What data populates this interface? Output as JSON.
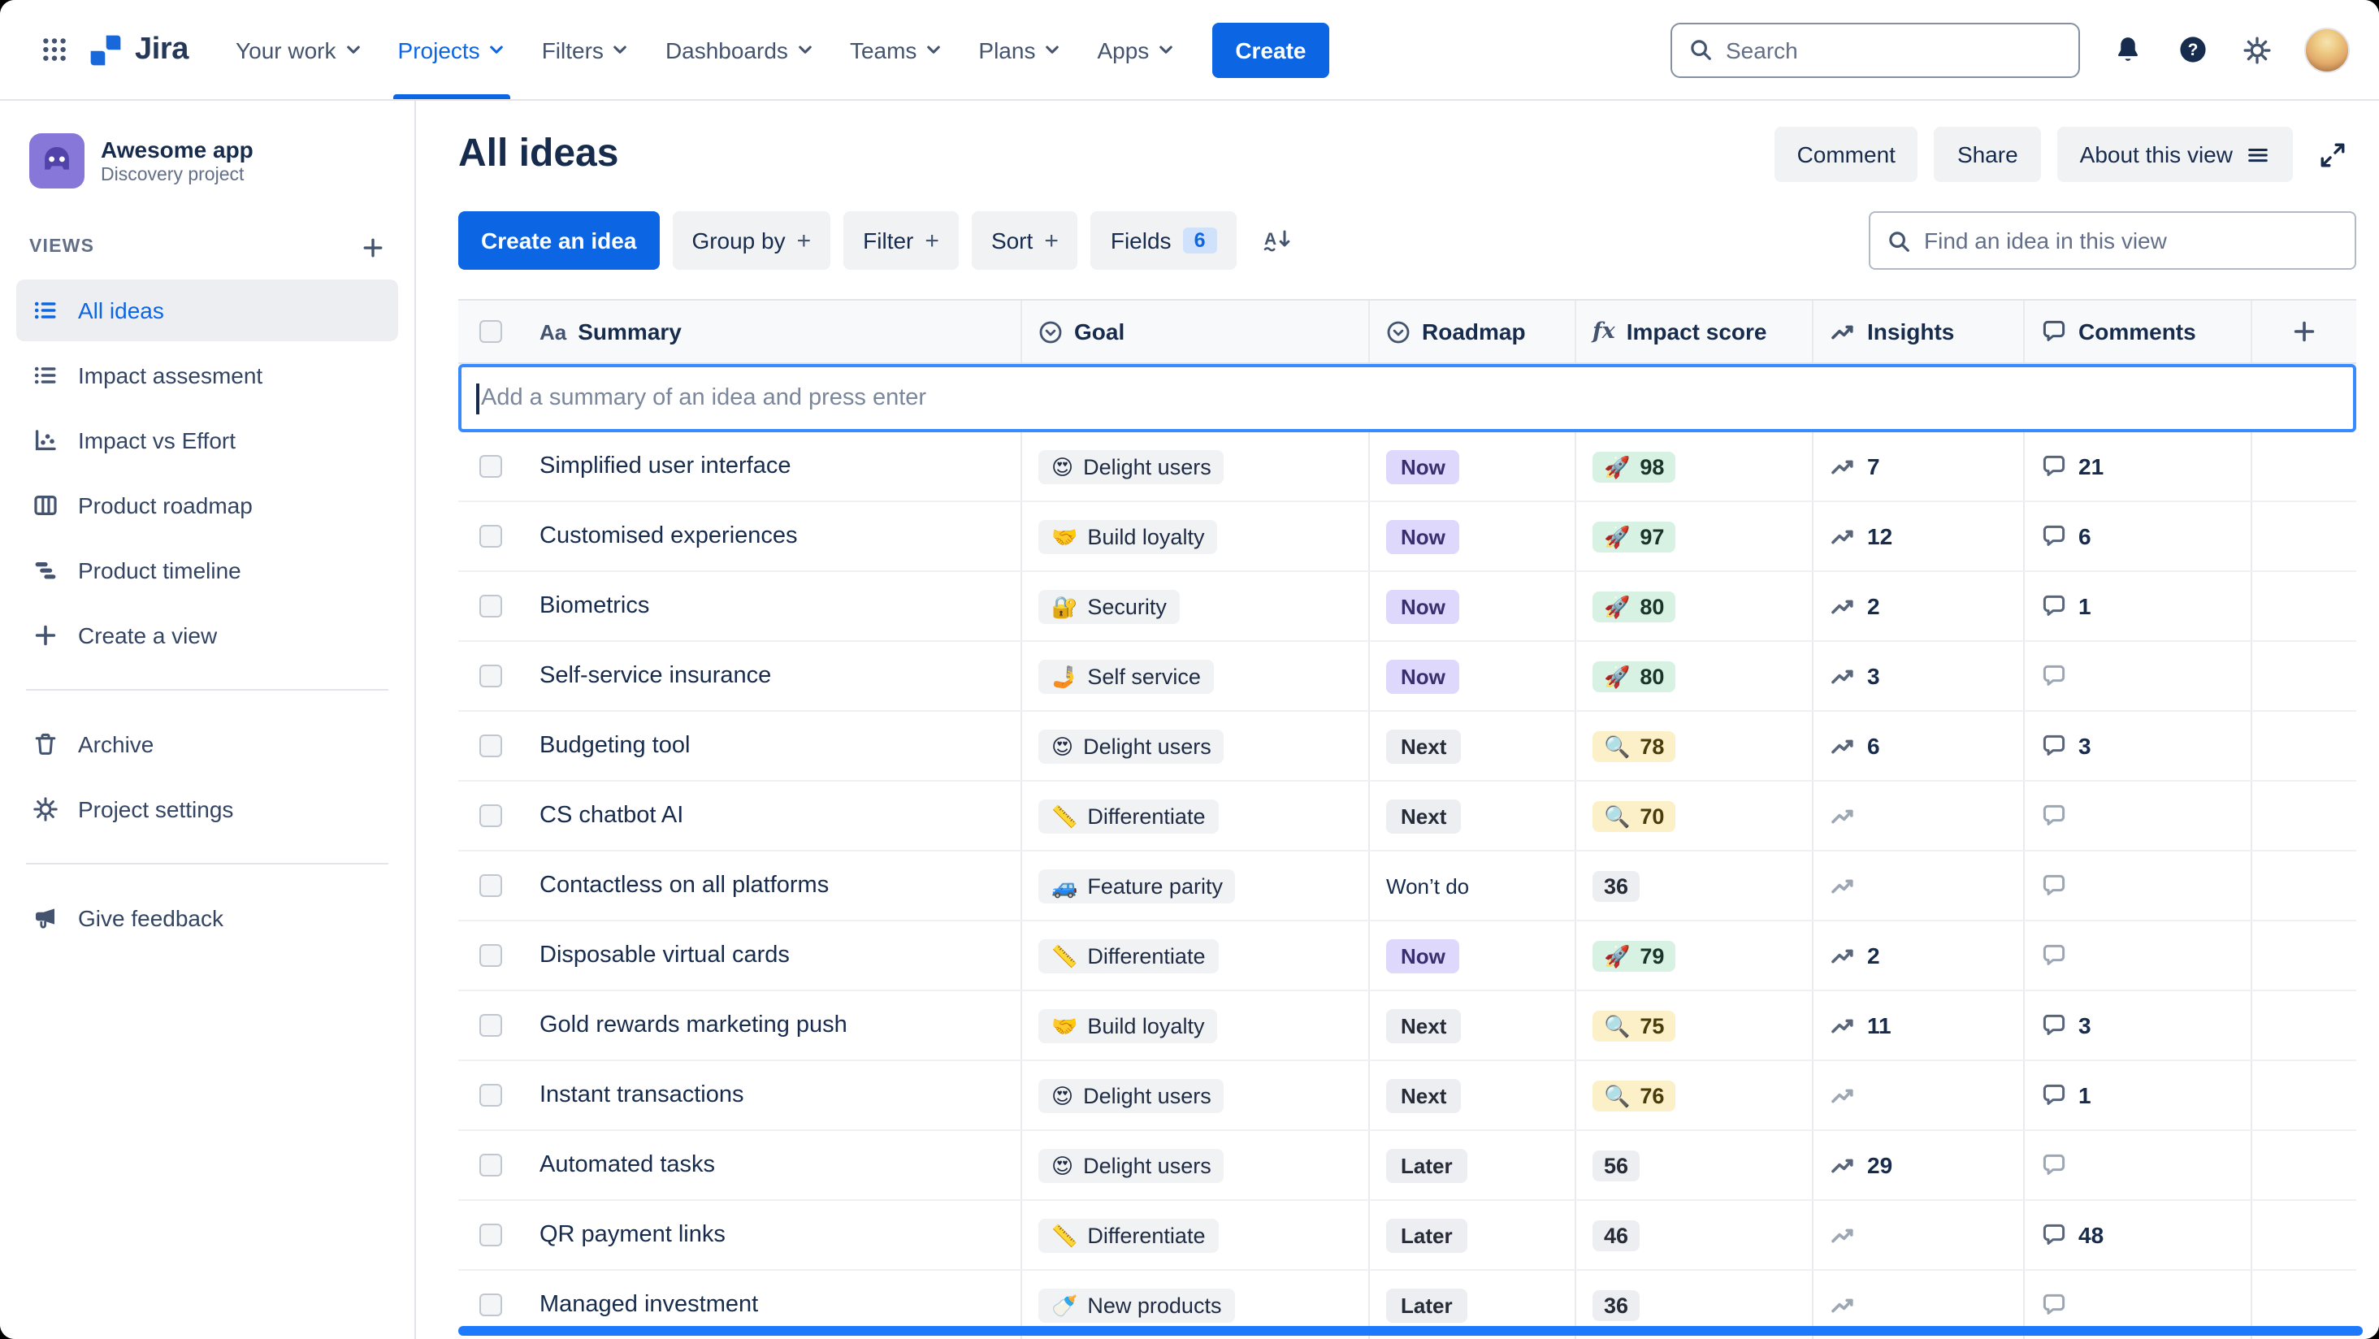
{
  "colors": {
    "accent": "#0C66E4",
    "roadmap_now": "#DFD8FD",
    "score_green": "#D7F2E3",
    "score_yellow": "#FBF0C7",
    "scrollbar_blue": "#1D7AFC"
  },
  "topnav": {
    "logo": "Jira",
    "items": [
      {
        "label": "Your work"
      },
      {
        "label": "Projects"
      },
      {
        "label": "Filters"
      },
      {
        "label": "Dashboards"
      },
      {
        "label": "Teams"
      },
      {
        "label": "Plans"
      },
      {
        "label": "Apps"
      }
    ],
    "create_label": "Create",
    "search_placeholder": "Search"
  },
  "sidebar": {
    "project_name": "Awesome app",
    "project_type": "Discovery project",
    "views_label": "VIEWS",
    "views": [
      {
        "label": "All ideas"
      },
      {
        "label": "Impact assesment"
      },
      {
        "label": "Impact vs Effort"
      },
      {
        "label": "Product roadmap"
      },
      {
        "label": "Product timeline"
      },
      {
        "label": "Create a view"
      }
    ],
    "archive_label": "Archive",
    "settings_label": "Project settings",
    "feedback_label": "Give feedback"
  },
  "page": {
    "title": "All ideas",
    "comment_label": "Comment",
    "share_label": "Share",
    "about_label": "About this view"
  },
  "toolbar": {
    "create_idea_label": "Create an idea",
    "group_by_label": "Group by",
    "filter_label": "Filter",
    "sort_label": "Sort",
    "fields_label": "Fields",
    "fields_count": "6",
    "find_placeholder": "Find an idea in this view"
  },
  "table": {
    "columns": {
      "summary": "Summary",
      "goal": "Goal",
      "roadmap": "Roadmap",
      "impact": "Impact score",
      "insights": "Insights",
      "comments": "Comments"
    },
    "add_row_placeholder": "Add a summary of an idea and press enter",
    "rows": [
      {
        "summary": "Simplified user interface",
        "goal_emoji": "😍",
        "goal": "Delight users",
        "roadmap": "Now",
        "roadmap_variant": "now",
        "score": "98",
        "score_emoji": "🚀",
        "score_variant": "green",
        "insights": "7",
        "comments": "21"
      },
      {
        "summary": "Customised experiences",
        "goal_emoji": "🤝",
        "goal": "Build loyalty",
        "roadmap": "Now",
        "roadmap_variant": "now",
        "score": "97",
        "score_emoji": "🚀",
        "score_variant": "green",
        "insights": "12",
        "comments": "6"
      },
      {
        "summary": "Biometrics",
        "goal_emoji": "🔐",
        "goal": "Security",
        "roadmap": "Now",
        "roadmap_variant": "now",
        "score": "80",
        "score_emoji": "🚀",
        "score_variant": "green",
        "insights": "2",
        "comments": "1"
      },
      {
        "summary": "Self-service insurance",
        "goal_emoji": "🤳",
        "goal": "Self service",
        "roadmap": "Now",
        "roadmap_variant": "now",
        "score": "80",
        "score_emoji": "🚀",
        "score_variant": "green",
        "insights": "3",
        "comments": ""
      },
      {
        "summary": "Budgeting tool",
        "goal_emoji": "😍",
        "goal": "Delight users",
        "roadmap": "Next",
        "roadmap_variant": "next",
        "score": "78",
        "score_emoji": "🔍",
        "score_variant": "yellow",
        "insights": "6",
        "comments": "3"
      },
      {
        "summary": "CS chatbot AI",
        "goal_emoji": "📏",
        "goal": "Differentiate",
        "roadmap": "Next",
        "roadmap_variant": "next",
        "score": "70",
        "score_emoji": "🔍",
        "score_variant": "yellow",
        "insights": "",
        "comments": ""
      },
      {
        "summary": "Contactless on all platforms",
        "goal_emoji": "🚙",
        "goal": "Feature parity",
        "roadmap": "Won’t do",
        "roadmap_variant": "wontdo",
        "score": "36",
        "score_emoji": "",
        "score_variant": "neutral",
        "insights": "",
        "comments": ""
      },
      {
        "summary": "Disposable virtual cards",
        "goal_emoji": "📏",
        "goal": "Differentiate",
        "roadmap": "Now",
        "roadmap_variant": "now",
        "score": "79",
        "score_emoji": "🚀",
        "score_variant": "green",
        "insights": "2",
        "comments": ""
      },
      {
        "summary": "Gold rewards marketing push",
        "goal_emoji": "🤝",
        "goal": "Build loyalty",
        "roadmap": "Next",
        "roadmap_variant": "next",
        "score": "75",
        "score_emoji": "🔍",
        "score_variant": "yellow",
        "insights": "11",
        "comments": "3"
      },
      {
        "summary": "Instant transactions",
        "goal_emoji": "😍",
        "goal": "Delight users",
        "roadmap": "Next",
        "roadmap_variant": "next",
        "score": "76",
        "score_emoji": "🔍",
        "score_variant": "yellow",
        "insights": "",
        "comments": "1"
      },
      {
        "summary": "Automated tasks",
        "goal_emoji": "😍",
        "goal": "Delight users",
        "roadmap": "Later",
        "roadmap_variant": "later",
        "score": "56",
        "score_emoji": "",
        "score_variant": "neutral",
        "insights": "29",
        "comments": ""
      },
      {
        "summary": "QR payment links",
        "goal_emoji": "📏",
        "goal": "Differentiate",
        "roadmap": "Later",
        "roadmap_variant": "later",
        "score": "46",
        "score_emoji": "",
        "score_variant": "neutral",
        "insights": "",
        "comments": "48"
      },
      {
        "summary": "Managed investment",
        "goal_emoji": "🍼",
        "goal": "New products",
        "roadmap": "Later",
        "roadmap_variant": "later",
        "score": "36",
        "score_emoji": "",
        "score_variant": "neutral",
        "insights": "",
        "comments": ""
      }
    ]
  }
}
